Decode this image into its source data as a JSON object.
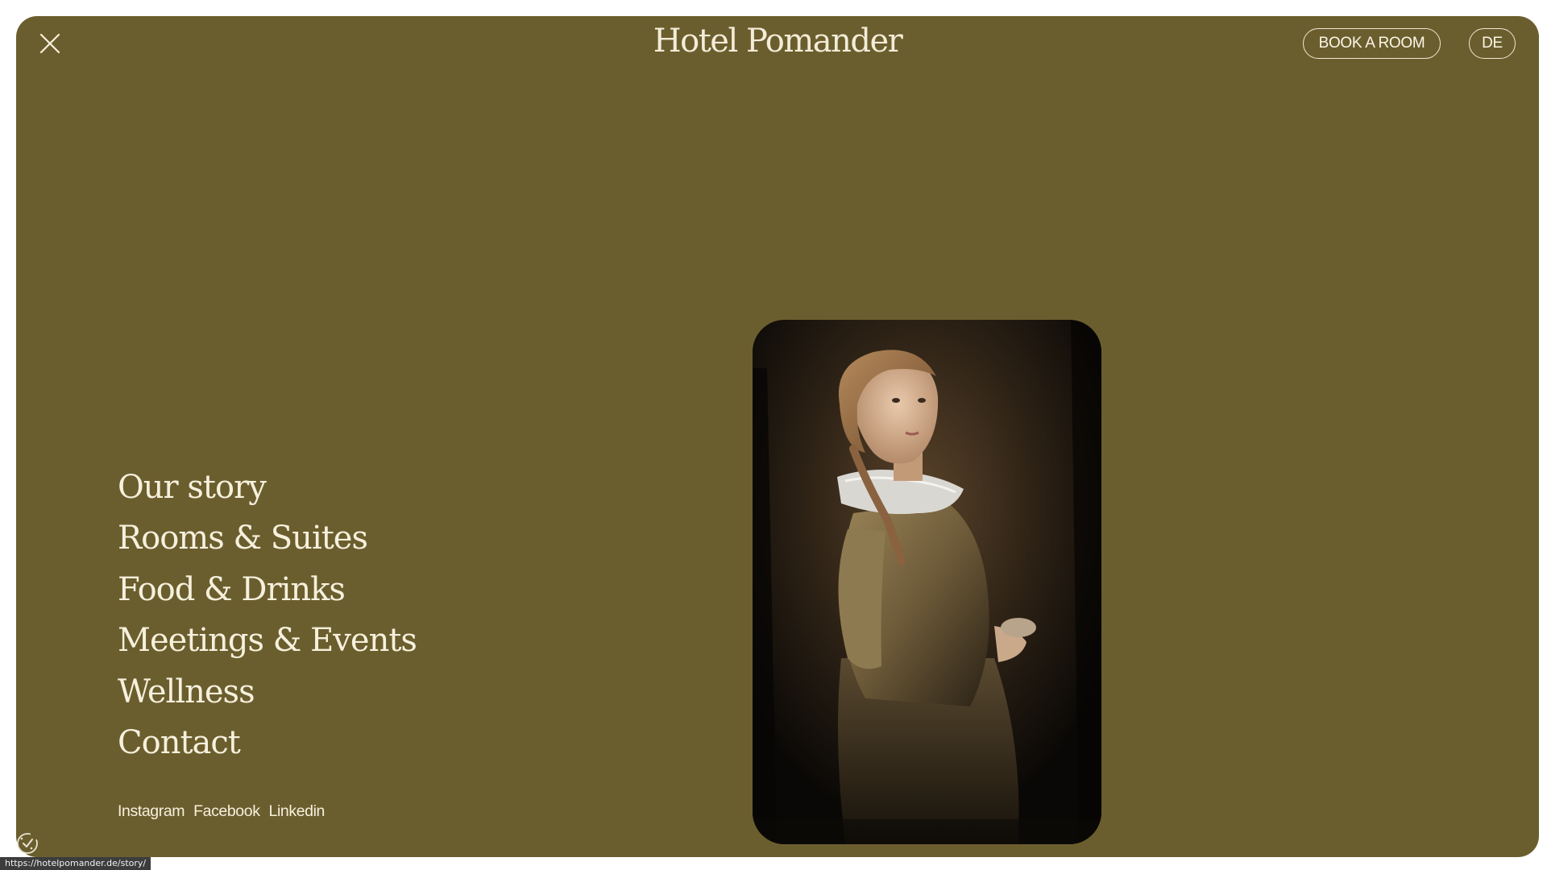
{
  "header": {
    "brand": "Hotel Pomander",
    "book_label": "BOOK A ROOM",
    "lang_label": "DE",
    "close_icon": "close-icon"
  },
  "nav": {
    "items": [
      {
        "label": "Our story"
      },
      {
        "label": "Rooms & Suites"
      },
      {
        "label": "Food & Drinks"
      },
      {
        "label": "Meetings & Events"
      },
      {
        "label": "Wellness"
      },
      {
        "label": "Contact"
      }
    ]
  },
  "socials": {
    "items": [
      {
        "label": "Instagram"
      },
      {
        "label": "Facebook"
      },
      {
        "label": "Linkedin"
      }
    ]
  },
  "feature_image": {
    "subject": "portrait-painting-icon"
  },
  "cookie": {
    "icon": "cookie-consent-icon"
  },
  "status_bar": {
    "url": "https://hotelpomander.de/story/"
  },
  "colors": {
    "panel_bg": "#6b5e2e",
    "text": "#f6f0dd",
    "page_bg": "#ffffff"
  }
}
